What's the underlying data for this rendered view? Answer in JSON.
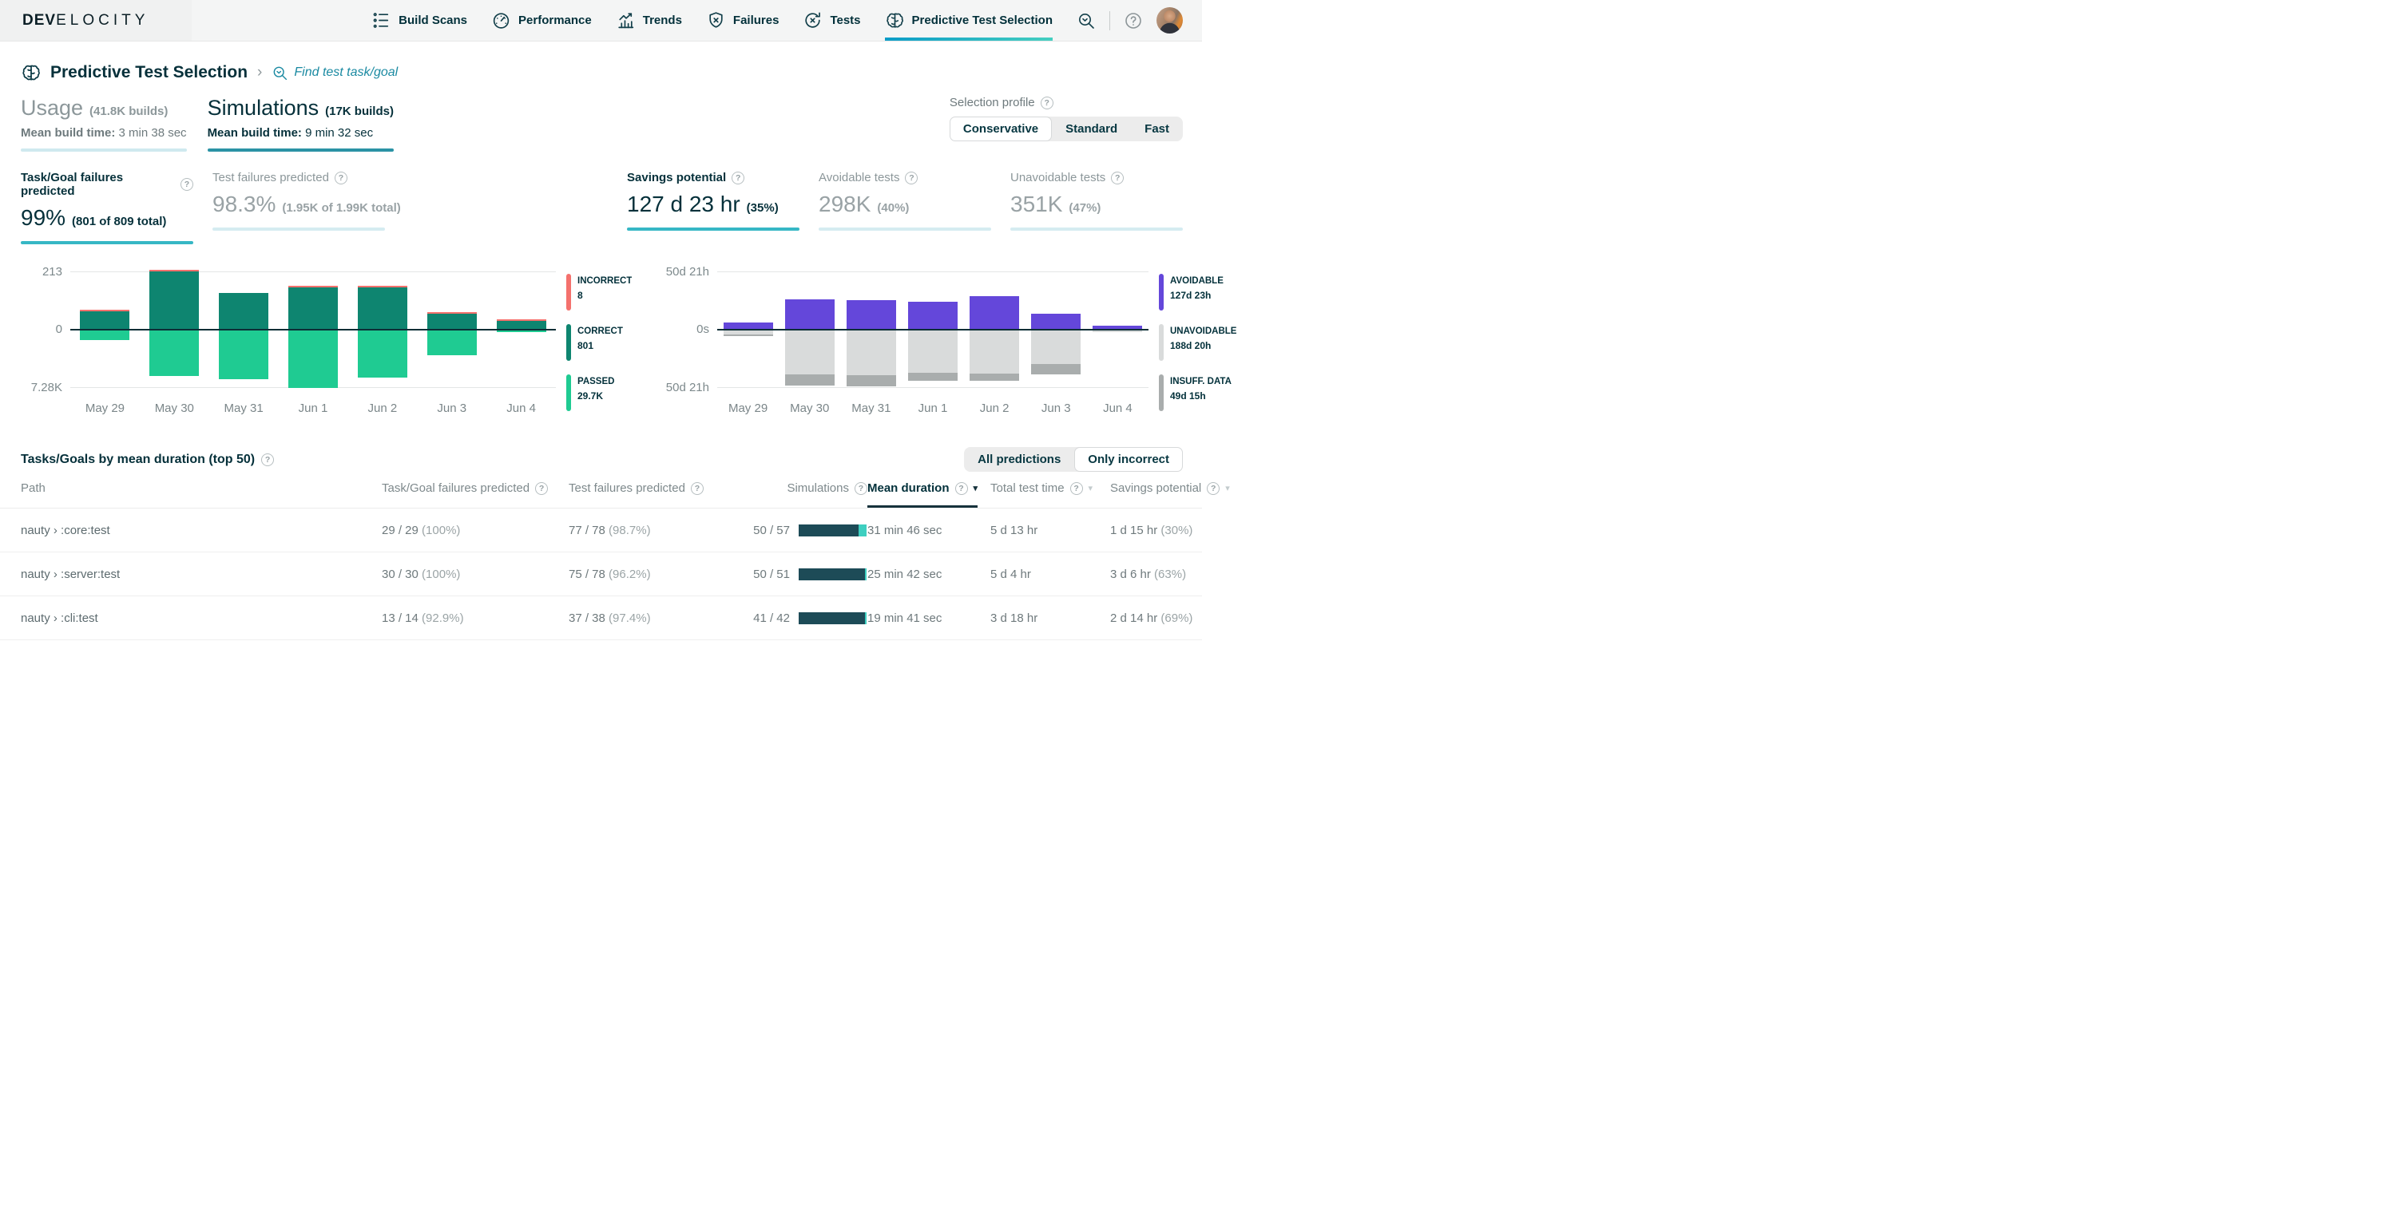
{
  "theme": {
    "text_dark": "#02303a",
    "link_teal": "#1b8aa2",
    "underline_active": "#36b7c5",
    "underline_inactive": "#d5ecf1",
    "nav_active_gradient": [
      "#0b9cc7",
      "#45cfc0"
    ]
  },
  "nav": {
    "logo_bold": "DEV",
    "logo_light": "ELOCITY",
    "items": [
      {
        "label": "Build Scans",
        "icon": "build-scans-icon",
        "active": false
      },
      {
        "label": "Performance",
        "icon": "performance-icon",
        "active": false
      },
      {
        "label": "Trends",
        "icon": "trends-icon",
        "active": false
      },
      {
        "label": "Failures",
        "icon": "failures-icon",
        "active": false
      },
      {
        "label": "Tests",
        "icon": "tests-icon",
        "active": false
      },
      {
        "label": "Predictive Test Selection",
        "icon": "predictive-icon",
        "active": true
      }
    ],
    "tools": [
      "search-icon",
      "help-icon",
      "avatar"
    ]
  },
  "breadcrumb": {
    "title": "Predictive Test Selection",
    "separator": "›",
    "link_label": "Find test task/goal"
  },
  "tabs": [
    {
      "title": "Usage",
      "count": "(41.8K builds)",
      "meta_label": "Mean build time:",
      "meta_value": "3 min 38 sec",
      "active": false
    },
    {
      "title": "Simulations",
      "count": "(17K builds)",
      "meta_label": "Mean build time:",
      "meta_value": "9 min 32 sec",
      "active": true
    }
  ],
  "selection_profile": {
    "label": "Selection profile",
    "options": [
      "Conservative",
      "Standard",
      "Fast"
    ],
    "selected": "Conservative"
  },
  "stats": {
    "left": [
      {
        "label": "Task/Goal failures predicted",
        "value": "99%",
        "detail": "(801 of 809 total)",
        "active": true
      },
      {
        "label": "Test failures predicted",
        "value": "98.3%",
        "detail": "(1.95K of 1.99K total)",
        "active": false
      }
    ],
    "right": [
      {
        "label": "Savings potential",
        "value": "127 d 23 hr",
        "detail": "(35%)",
        "active": true
      },
      {
        "label": "Avoidable tests",
        "value": "298K",
        "detail": "(40%)",
        "active": false
      },
      {
        "label": "Unavoidable tests",
        "value": "351K",
        "detail": "(47%)",
        "active": false
      }
    ]
  },
  "chart_data": [
    {
      "type": "bar",
      "variant": "diverging-stacked",
      "title": "Task/Goal prediction outcomes per day",
      "categories": [
        "May 29",
        "May 30",
        "May 31",
        "Jun 1",
        "Jun 2",
        "Jun 3",
        "Jun 4"
      ],
      "y_axis_labels": {
        "top": "213",
        "zero": "0",
        "bottom": "7.28K"
      },
      "ylim": {
        "up": 213,
        "down": 7280
      },
      "grid": "horizontal",
      "legend_position": "right",
      "series": [
        {
          "name": "INCORRECT",
          "legend_value": "8",
          "color": "#f4716d",
          "direction": "up",
          "values": [
            1,
            2,
            0,
            2,
            1,
            1,
            1
          ]
        },
        {
          "name": "CORRECT",
          "legend_value": "801",
          "color": "#0e8570",
          "direction": "up",
          "values": [
            64,
            212,
            132,
            153,
            154,
            56,
            30
          ]
        },
        {
          "name": "PASSED",
          "legend_value": "29.7K",
          "color": "#1fcb92",
          "direction": "down",
          "values": [
            1200,
            5725,
            6150,
            7265,
            5930,
            3110,
            220
          ]
        }
      ]
    },
    {
      "type": "bar",
      "variant": "diverging-stacked",
      "title": "Test time savings per day",
      "categories": [
        "May 29",
        "May 30",
        "May 31",
        "Jun 1",
        "Jun 2",
        "Jun 3",
        "Jun 4"
      ],
      "y_axis_labels": {
        "top": "50d 21h",
        "zero": "0s",
        "bottom": "50d 21h"
      },
      "ylim": {
        "up": 1221,
        "down": 1221
      },
      "unit": "hours",
      "grid": "horizontal",
      "legend_position": "right",
      "series": [
        {
          "name": "AVOIDABLE",
          "legend_value": "127d 23h",
          "color": "#6447da",
          "direction": "up",
          "values": [
            137,
            635,
            615,
            583,
            689,
            329,
            74
          ]
        },
        {
          "name": "UNAVOIDABLE",
          "legend_value": "188d 20h",
          "color": "#d9dbdb",
          "direction": "down",
          "values": [
            86,
            926,
            949,
            900,
            917,
            719,
            37
          ]
        },
        {
          "name": "INSUFF. DATA",
          "legend_value": "49d 15h",
          "color": "#a9adad",
          "direction": "down",
          "values": [
            10,
            250,
            230,
            170,
            150,
            210,
            0
          ]
        }
      ]
    }
  ],
  "table": {
    "title": "Tasks/Goals by mean duration (top 50)",
    "filter": {
      "options": [
        "All predictions",
        "Only incorrect"
      ],
      "selected": "Only incorrect"
    },
    "sim_bar_colors": {
      "filled": "#1d4b57",
      "remainder": "#3ecfc0"
    },
    "columns": [
      {
        "label": "Path",
        "help": false,
        "sortable": false,
        "sorted": false,
        "align": "left"
      },
      {
        "label": "Task/Goal failures predicted",
        "help": true,
        "sortable": false,
        "sorted": false,
        "align": "left"
      },
      {
        "label": "Test failures predicted",
        "help": true,
        "sortable": false,
        "sorted": false,
        "align": "left"
      },
      {
        "label": "Simulations",
        "help": true,
        "sortable": false,
        "sorted": false,
        "align": "right"
      },
      {
        "label": "Mean duration",
        "help": true,
        "sortable": true,
        "sorted": true,
        "align": "left"
      },
      {
        "label": "Total test time",
        "help": true,
        "sortable": true,
        "sorted": false,
        "align": "left"
      },
      {
        "label": "Savings potential",
        "help": true,
        "sortable": true,
        "sorted": false,
        "align": "left"
      }
    ],
    "rows": [
      {
        "path": "nauty › :core:test",
        "task_goal": "29 / 29",
        "task_goal_pct": "(100%)",
        "test": "77 / 78",
        "test_pct": "(98.7%)",
        "simulations": "50 / 57",
        "simulations_ratio": 0.877,
        "mean_duration": "31 min 46 sec",
        "total_test_time": "5 d 13 hr",
        "savings": "1 d 15 hr",
        "savings_pct": "(30%)"
      },
      {
        "path": "nauty › :server:test",
        "task_goal": "30 / 30",
        "task_goal_pct": "(100%)",
        "test": "75 / 78",
        "test_pct": "(96.2%)",
        "simulations": "50 / 51",
        "simulations_ratio": 0.98,
        "mean_duration": "25 min 42 sec",
        "total_test_time": "5 d 4 hr",
        "savings": "3 d 6 hr",
        "savings_pct": "(63%)"
      },
      {
        "path": "nauty › :cli:test",
        "task_goal": "13 / 14",
        "task_goal_pct": "(92.9%)",
        "test": "37 / 38",
        "test_pct": "(97.4%)",
        "simulations": "41 / 42",
        "simulations_ratio": 0.976,
        "mean_duration": "19 min 41 sec",
        "total_test_time": "3 d 18 hr",
        "savings": "2 d 14 hr",
        "savings_pct": "(69%)"
      }
    ]
  }
}
